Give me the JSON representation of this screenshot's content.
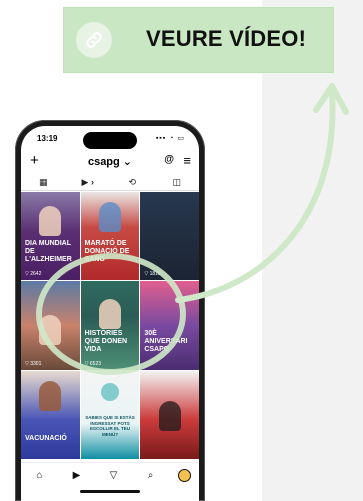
{
  "cta": {
    "label": "VEURE VÍDEO!",
    "icon": "link-icon",
    "background": "#c9e7c3"
  },
  "phone": {
    "status": {
      "time": "13:19",
      "icons": "▪▪▪ ◔ ▭"
    },
    "header": {
      "plus": "+",
      "username": "csapg ⌄",
      "threads": "@",
      "menu": "≡"
    },
    "tabs": [
      {
        "label": "▦",
        "name": "grid"
      },
      {
        "label": "▶ ›",
        "name": "reels"
      },
      {
        "label": "⟲",
        "name": "reposts"
      },
      {
        "label": "◫",
        "name": "tagged"
      }
    ],
    "tiles": [
      {
        "title": "DIA MUNDIAL DE L'ALZHEIMER",
        "views": "▽ 2642"
      },
      {
        "title": "MARATÓ DE DONACIÓ DE SANG",
        "views": ""
      },
      {
        "title": "",
        "views": "▽ 1815"
      },
      {
        "title": "",
        "views": "▽ 3301"
      },
      {
        "title": "HISTÒRIES QUE DONEN VIDA",
        "views": "▽ 6523"
      },
      {
        "title": "30È ANIVERSARI CSAPG",
        "views": ""
      },
      {
        "title": "VACUNACIÓ",
        "views": ""
      },
      {
        "title": "SABIES QUE SI ESTÀS INGRESSAT POTS ESCOLLIR EL TEU MENÚ?",
        "views": ""
      },
      {
        "title": "",
        "views": ""
      }
    ],
    "nav": [
      {
        "label": "⌂",
        "name": "home-icon"
      },
      {
        "label": "▶",
        "name": "reels-icon"
      },
      {
        "label": "▽",
        "name": "send-icon"
      },
      {
        "label": "⌕",
        "name": "search-icon"
      }
    ]
  },
  "accent": "#cfe8c8"
}
